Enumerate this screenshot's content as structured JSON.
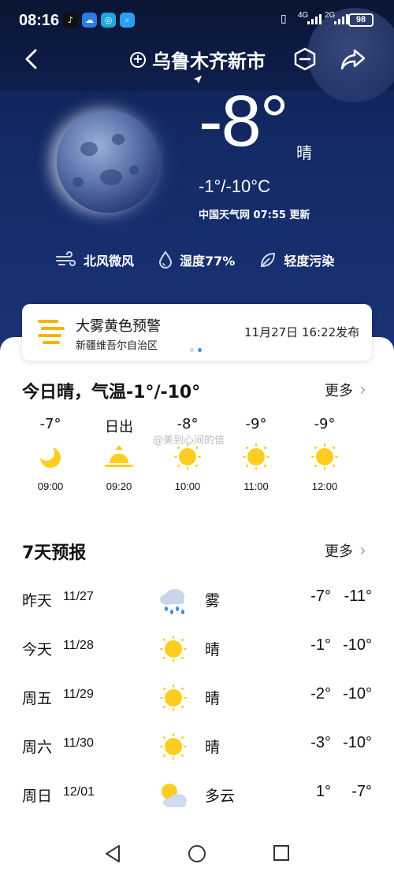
{
  "status": {
    "time": "08:16",
    "network1": "4G",
    "network2": "2G",
    "battery": "98"
  },
  "header": {
    "city": "乌鲁木齐新市"
  },
  "current": {
    "temp": "-8°",
    "condition": "晴",
    "range": "-1°/-10°C",
    "source": "中国天气网 07:55 更新",
    "wind": "北风微风",
    "humidity": "湿度77%",
    "pollution": "轻度污染"
  },
  "warning": {
    "title": "大雾黄色预警",
    "region": "新疆维吾尔自治区",
    "time": "11月27日 16:22发布",
    "color": "#f5b300"
  },
  "today": {
    "title": "今日晴，气温-1°/-10°",
    "more": "更多",
    "watermark": "@美到心间的信",
    "hours": [
      {
        "value": "-7°",
        "icon": "moon-icon",
        "time": "09:00"
      },
      {
        "value": "日出",
        "icon": "sunrise-icon",
        "time": "09:20"
      },
      {
        "value": "-8°",
        "icon": "sun-icon",
        "time": "10:00"
      },
      {
        "value": "-9°",
        "icon": "sun-icon",
        "time": "11:00"
      },
      {
        "value": "-9°",
        "icon": "sun-icon",
        "time": "12:00"
      }
    ]
  },
  "forecast": {
    "title": "7天预报",
    "more": "更多",
    "days": [
      {
        "day": "昨天",
        "date": "11/27",
        "icon": "fog-rain-icon",
        "weather": "雾",
        "high": "-7°",
        "low": "-11°"
      },
      {
        "day": "今天",
        "date": "11/28",
        "icon": "sun-icon",
        "weather": "晴",
        "high": "-1°",
        "low": "-10°"
      },
      {
        "day": "周五",
        "date": "11/29",
        "icon": "sun-icon",
        "weather": "晴",
        "high": "-2°",
        "low": "-10°"
      },
      {
        "day": "周六",
        "date": "11/30",
        "icon": "sun-icon",
        "weather": "晴",
        "high": "-3°",
        "low": "-10°"
      },
      {
        "day": "周日",
        "date": "12/01",
        "icon": "partly-cloudy-icon",
        "weather": "多云",
        "high": "1°",
        "low": "-7°"
      }
    ]
  }
}
